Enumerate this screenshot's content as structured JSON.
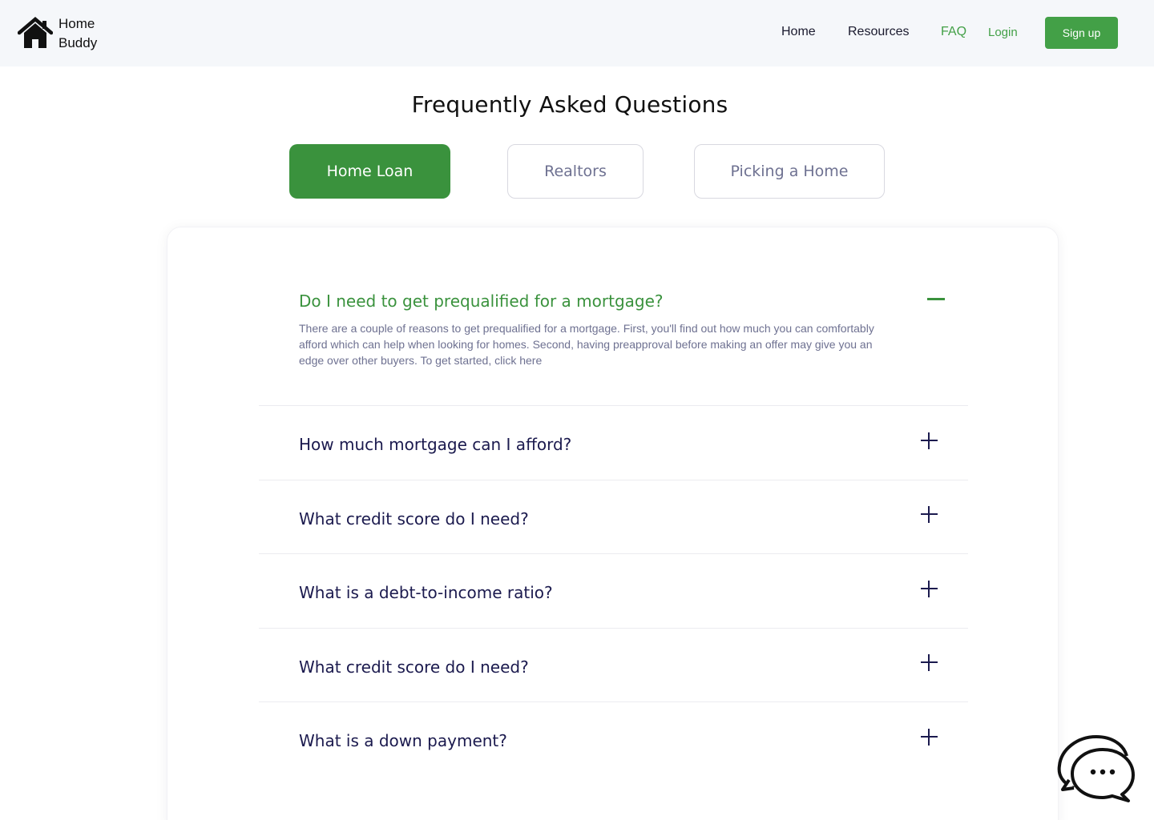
{
  "brand": {
    "line1": "Home",
    "line2": "Buddy",
    "icon": "house-icon"
  },
  "nav": {
    "home": "Home",
    "resources": "Resources",
    "faq": "FAQ",
    "login": "Login",
    "signup": "Sign up"
  },
  "page": {
    "title": "Frequently Asked Questions"
  },
  "tabs": [
    {
      "label": "Home Loan",
      "active": true
    },
    {
      "label": "Realtors",
      "active": false
    },
    {
      "label": "Picking a Home",
      "active": false
    }
  ],
  "faq": {
    "open": {
      "question": "Do I need to get prequalified for a mortgage?",
      "answer": "There are a couple of reasons to get prequalified for a mortgage. First, you'll find out how much you can comfortably afford which can help when looking for homes. Second, having preapproval before making an offer may give you an edge over other buyers. To get started, click here"
    },
    "items": [
      {
        "question": "How much mortgage can I afford?"
      },
      {
        "question": "What credit score do I need?"
      },
      {
        "question": "What is a debt-to-income ratio?"
      },
      {
        "question": "What credit score do I need?"
      },
      {
        "question": "What is a down payment?"
      }
    ]
  },
  "colors": {
    "accent": "#43a047",
    "accent_dark": "#3a923d",
    "question_text": "#1b1a4e",
    "muted_text": "#6e7191",
    "header_bg": "#f5f7fa"
  },
  "icons": {
    "collapse": "minus-icon",
    "expand": "plus-icon",
    "chat": "chat-bubbles-icon"
  }
}
